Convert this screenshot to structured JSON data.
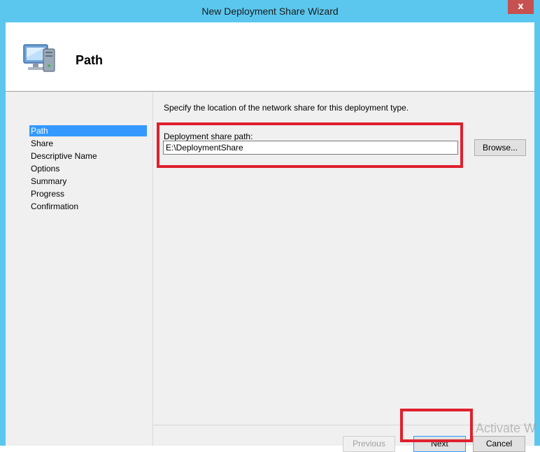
{
  "window": {
    "title": "New Deployment Share Wizard",
    "close_glyph": "x",
    "accent": "#5bc7ee"
  },
  "header": {
    "title": "Path",
    "icon": "computer-icon"
  },
  "nav": {
    "items": [
      "Path",
      "Share",
      "Descriptive Name",
      "Options",
      "Summary",
      "Progress",
      "Confirmation"
    ],
    "active_index": 0
  },
  "content": {
    "instruction": "Specify the location of the network share for this deployment type.",
    "path_label": "Deployment share path:",
    "path_value": "E:\\DeploymentShare",
    "browse_label": "Browse..."
  },
  "footer": {
    "previous_label": "Previous",
    "next_label": "Next",
    "cancel_label": "Cancel"
  },
  "watermark": "Activate Win",
  "annotation_color": "#e0202d"
}
